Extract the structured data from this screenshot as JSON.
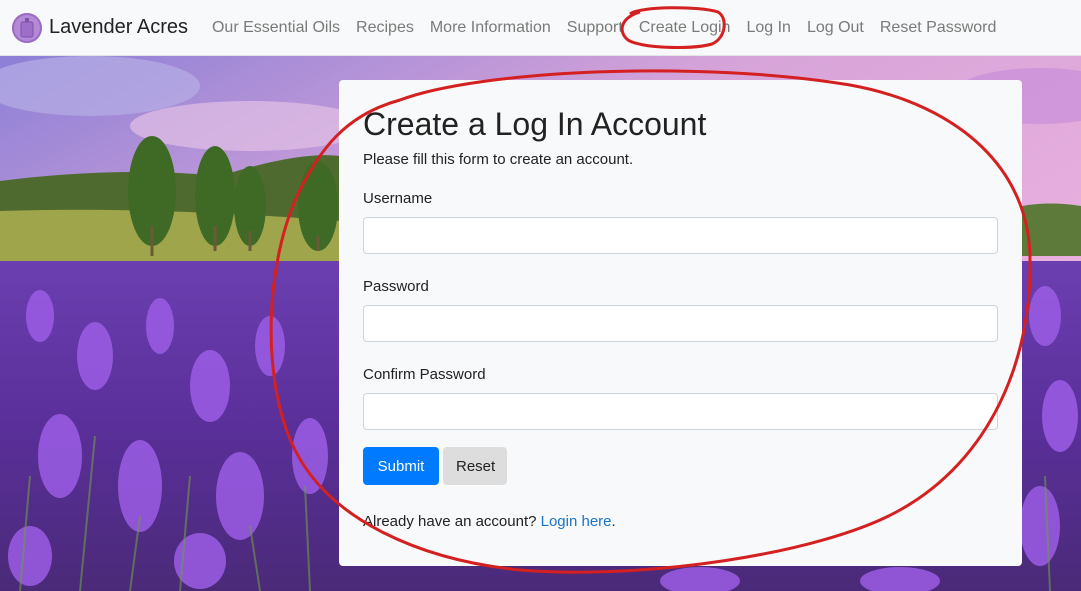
{
  "navbar": {
    "brand": "Lavender Acres",
    "links": [
      "Our Essential Oils",
      "Recipes",
      "More Information",
      "Support",
      "Create Login",
      "Log In",
      "Log Out",
      "Reset Password"
    ]
  },
  "form": {
    "title": "Create a Log In Account",
    "subtitle": "Please fill this form to create an account.",
    "username_label": "Username",
    "username_value": "",
    "password_label": "Password",
    "password_value": "",
    "confirm_label": "Confirm Password",
    "confirm_value": "",
    "submit_label": "Submit",
    "reset_label": "Reset",
    "footer_text": "Already have an account?",
    "footer_link": "Login here",
    "footer_end": "."
  },
  "colors": {
    "primary": "#007bff",
    "annotation": "#d42020",
    "lavender": "#8a4fc7"
  }
}
